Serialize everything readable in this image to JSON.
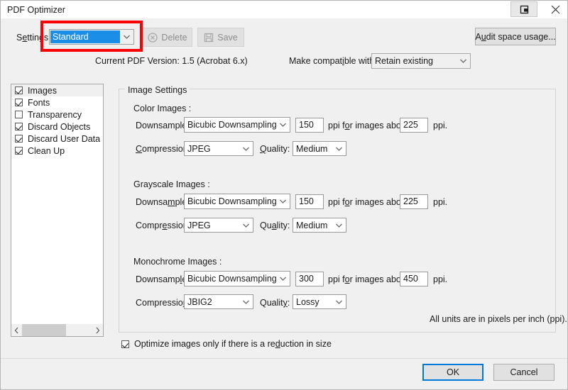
{
  "window": {
    "title": "PDF Optimizer",
    "restore_icon": "restore-down-icon",
    "close_icon": "close-icon"
  },
  "toolbar": {
    "settings_label_pre": "S",
    "settings_label_acc": "e",
    "settings_label_post": "ttings:",
    "settings_label": "Settings:",
    "settings_value": "Standard",
    "delete_label": "Delete",
    "delete_icon": "circle-x-icon",
    "save_label": "Save",
    "save_icon": "floppy-disk-icon",
    "audit_label": "Audit space usage...",
    "audit_icon": "audit-icon",
    "current_version": "Current PDF Version: 1.5 (Acrobat 6.x)",
    "compat_label": "Make compatible with:",
    "compat_value": "Retain existing"
  },
  "sidebar": {
    "items": [
      {
        "label": "Images",
        "checked": true,
        "selected": true
      },
      {
        "label": "Fonts",
        "checked": true,
        "selected": false
      },
      {
        "label": "Transparency",
        "checked": false,
        "selected": false
      },
      {
        "label": "Discard Objects",
        "checked": true,
        "selected": false
      },
      {
        "label": "Discard User Data",
        "checked": true,
        "selected": false
      },
      {
        "label": "Clean Up",
        "checked": true,
        "selected": false
      }
    ],
    "scroll_left_icon": "chevron-left-icon",
    "scroll_right_icon": "chevron-right-icon"
  },
  "main": {
    "group_title": "Image Settings",
    "sections": [
      {
        "heading": "Color Images :",
        "downsample_label": "Downsample:",
        "downsample_value": "Bicubic Downsampling to",
        "ppi_value": "150",
        "mid_text": "ppi for images above",
        "threshold_value": "225",
        "ppi_suffix": "ppi.",
        "compression_label": "Compression:",
        "compression_value": "JPEG",
        "quality_label": "Quality:",
        "quality_value": "Medium"
      },
      {
        "heading": "Grayscale Images :",
        "downsample_label": "Downsample:",
        "downsample_value": "Bicubic Downsampling to",
        "ppi_value": "150",
        "mid_text": "ppi for images above",
        "threshold_value": "225",
        "ppi_suffix": "ppi.",
        "compression_label": "Compression:",
        "compression_value": "JPEG",
        "quality_label": "Quality:",
        "quality_value": "Medium"
      },
      {
        "heading": "Monochrome Images :",
        "downsample_label": "Downsample:",
        "downsample_value": "Bicubic Downsampling to",
        "ppi_value": "300",
        "mid_text": "ppi for images above",
        "threshold_value": "450",
        "ppi_suffix": "ppi.",
        "compression_label": "Compression:",
        "compression_value": "JBIG2",
        "quality_label": "Quality:",
        "quality_value": "Lossy"
      }
    ],
    "units_note": "All units are in pixels per inch (ppi)."
  },
  "footer": {
    "optimize_checkbox_label": "Optimize images only if there is a reduction in size",
    "optimize_checked": true,
    "ok_label": "OK",
    "cancel_label": "Cancel"
  },
  "annotation": {
    "highlight_color": "#fb0007",
    "target": "settings-combo"
  }
}
